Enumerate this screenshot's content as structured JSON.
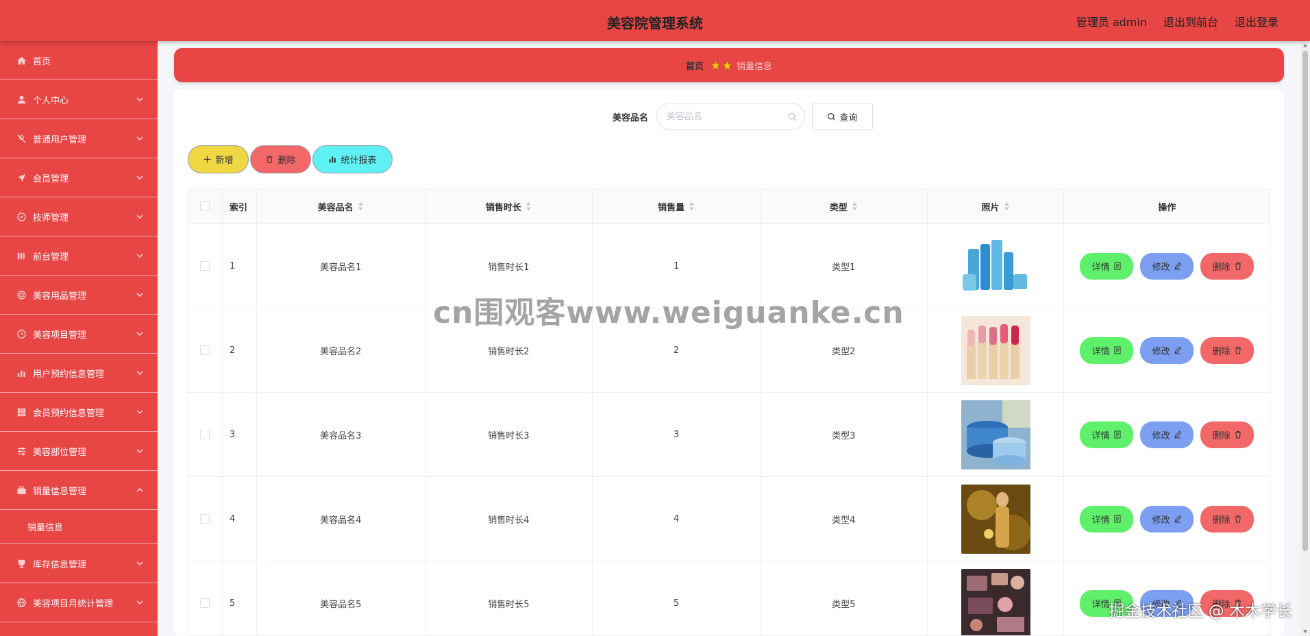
{
  "header": {
    "title": "美容院管理系统",
    "admin_label": "管理员 admin",
    "to_front": "退出到前台",
    "logout": "退出登录"
  },
  "sidebar": {
    "items": [
      {
        "label": "首页",
        "icon": "home-icon",
        "arrow": false
      },
      {
        "label": "个人中心",
        "icon": "user-icon",
        "arrow": true
      },
      {
        "label": "普通用户管理",
        "icon": "users-off-icon",
        "arrow": true
      },
      {
        "label": "会员管理",
        "icon": "send-icon",
        "arrow": true
      },
      {
        "label": "技师管理",
        "icon": "compass-icon",
        "arrow": true
      },
      {
        "label": "前台管理",
        "icon": "bars-icon",
        "arrow": true
      },
      {
        "label": "美容用品管理",
        "icon": "target-icon",
        "arrow": true
      },
      {
        "label": "美容项目管理",
        "icon": "clock-icon",
        "arrow": true
      },
      {
        "label": "用户预约信息管理",
        "icon": "chart-icon",
        "arrow": true
      },
      {
        "label": "会员预约信息管理",
        "icon": "grid-icon",
        "arrow": true
      },
      {
        "label": "美容部位管理",
        "icon": "sliders-icon",
        "arrow": true
      },
      {
        "label": "销量信息管理",
        "icon": "briefcase-icon",
        "arrow": true,
        "expanded": true
      }
    ],
    "sub_item": "销量信息",
    "items_after": [
      {
        "label": "库存信息管理",
        "icon": "cup-icon",
        "arrow": true
      },
      {
        "label": "美容项目月统计管理",
        "icon": "globe-icon",
        "arrow": true
      }
    ]
  },
  "breadcrumb": {
    "home": "首页",
    "current": "销量信息"
  },
  "search": {
    "label": "美容品名",
    "placeholder": "美容品名",
    "button": "查询"
  },
  "actions": {
    "add": "新增",
    "delete": "删除",
    "report": "统计报表"
  },
  "table": {
    "headers": {
      "index": "索引",
      "name": "美容品名",
      "duration": "销售时长",
      "quantity": "销售量",
      "type": "类型",
      "photo": "照片",
      "ops": "操作"
    },
    "rows": [
      {
        "index": "1",
        "name": "美容品名1",
        "duration": "销售时长1",
        "quantity": "1",
        "type": "类型1"
      },
      {
        "index": "2",
        "name": "美容品名2",
        "duration": "销售时长2",
        "quantity": "2",
        "type": "类型2"
      },
      {
        "index": "3",
        "name": "美容品名3",
        "duration": "销售时长3",
        "quantity": "3",
        "type": "类型3"
      },
      {
        "index": "4",
        "name": "美容品名4",
        "duration": "销售时长4",
        "quantity": "4",
        "type": "类型4"
      },
      {
        "index": "5",
        "name": "美容品名5",
        "duration": "销售时长5",
        "quantity": "5",
        "type": "类型5"
      }
    ],
    "row_buttons": {
      "detail": "详情",
      "edit": "修改",
      "remove": "删除"
    }
  },
  "watermarks": {
    "center": "cn围观客www.weiguanke.cn",
    "corner": "掘金技术社区 @ 木木学长"
  },
  "colors": {
    "primary": "#e84545",
    "add": "#f0d844",
    "delete": "#f26767",
    "report": "#5ef0f3",
    "detail": "#5ef06a",
    "edit": "#7c9ff2"
  }
}
